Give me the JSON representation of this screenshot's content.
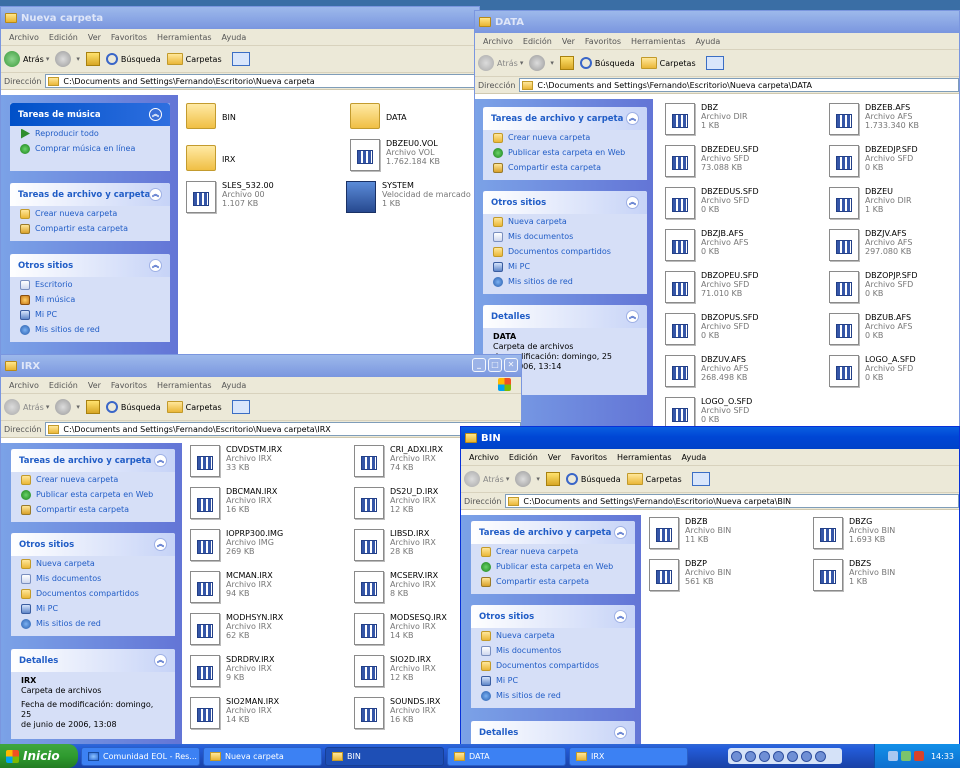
{
  "menu": [
    "Archivo",
    "Edición",
    "Ver",
    "Favoritos",
    "Herramientas",
    "Ayuda"
  ],
  "toolbar": {
    "back": "Atrás",
    "search": "Búsqueda",
    "folders": "Carpetas"
  },
  "address_label": "Dirección",
  "colors": {
    "titlebar_active": "#0a5fe0",
    "panel": "#7ba2e7",
    "task_header": "#215dc6",
    "start": "#3fa63f"
  },
  "windows": {
    "nueva": {
      "title": "Nueva carpeta",
      "address": "C:\\Documents and Settings\\Fernando\\Escritorio\\Nueva carpeta",
      "music_header": "Tareas de música",
      "music_items": [
        "Reproducir todo",
        "Comprar música en línea"
      ],
      "file_tasks_header": "Tareas de archivo y carpeta",
      "file_tasks": [
        "Crear nueva carpeta",
        "Compartir esta carpeta"
      ],
      "other_header": "Otros sitios",
      "other": [
        "Escritorio",
        "Mi música",
        "Mi PC",
        "Mis sitios de red"
      ],
      "files": [
        {
          "name": "BIN",
          "type": "",
          "size": "",
          "icon": "folder"
        },
        {
          "name": "DATA",
          "type": "",
          "size": "",
          "icon": "folder"
        },
        {
          "name": "IRX",
          "type": "",
          "size": "",
          "icon": "folder"
        },
        {
          "name": "DBZEU0.VOL",
          "type": "Archivo VOL",
          "size": "1.762.184 KB",
          "icon": "doc"
        },
        {
          "name": "SLES_532.00",
          "type": "Archivo 00",
          "size": "1.107 KB",
          "icon": "doc"
        },
        {
          "name": "SYSTEM",
          "type": "Velocidad de marcado",
          "size": "1 KB",
          "icon": "sys"
        }
      ]
    },
    "data": {
      "title": "DATA",
      "address": "C:\\Documents and Settings\\Fernando\\Escritorio\\Nueva carpeta\\DATA",
      "file_tasks_header": "Tareas de archivo y carpeta",
      "file_tasks": [
        "Crear nueva carpeta",
        "Publicar esta carpeta en Web",
        "Compartir esta carpeta"
      ],
      "other_header": "Otros sitios",
      "other": [
        "Nueva carpeta",
        "Mis documentos",
        "Documentos compartidos",
        "Mi PC",
        "Mis sitios de red"
      ],
      "details_header": "Detalles",
      "details_name": "DATA",
      "details_type": "Carpeta de archivos",
      "details_mod": "de modificación: domingo, 25",
      "details_date": "o de 2006, 13:14",
      "files": [
        {
          "name": "DBZ",
          "type": "Archivo DIR",
          "size": "1 KB"
        },
        {
          "name": "DBZEB.AFS",
          "type": "Archivo AFS",
          "size": "1.733.340 KB"
        },
        {
          "name": "DBZEDEU.SFD",
          "type": "Archivo SFD",
          "size": "73.088 KB"
        },
        {
          "name": "DBZEDJP.SFD",
          "type": "Archivo SFD",
          "size": "0 KB"
        },
        {
          "name": "DBZEDUS.SFD",
          "type": "Archivo SFD",
          "size": "0 KB"
        },
        {
          "name": "DBZEU",
          "type": "Archivo DIR",
          "size": "1 KB"
        },
        {
          "name": "DBZJB.AFS",
          "type": "Archivo AFS",
          "size": "0 KB"
        },
        {
          "name": "DBZJV.AFS",
          "type": "Archivo AFS",
          "size": "297.080 KB"
        },
        {
          "name": "DBZOPEU.SFD",
          "type": "Archivo SFD",
          "size": "71.010 KB"
        },
        {
          "name": "DBZOPJP.SFD",
          "type": "Archivo SFD",
          "size": "0 KB"
        },
        {
          "name": "DBZOPUS.SFD",
          "type": "Archivo SFD",
          "size": "0 KB"
        },
        {
          "name": "DBZUB.AFS",
          "type": "Archivo AFS",
          "size": "0 KB"
        },
        {
          "name": "DBZUV.AFS",
          "type": "Archivo AFS",
          "size": "268.498 KB"
        },
        {
          "name": "LOGO_A.SFD",
          "type": "Archivo SFD",
          "size": "0 KB"
        },
        {
          "name": "LOGO_O.SFD",
          "type": "Archivo SFD",
          "size": "0 KB"
        }
      ]
    },
    "irx": {
      "title": "IRX",
      "address": "C:\\Documents and Settings\\Fernando\\Escritorio\\Nueva carpeta\\IRX",
      "file_tasks_header": "Tareas de archivo y carpeta",
      "file_tasks": [
        "Crear nueva carpeta",
        "Publicar esta carpeta en Web",
        "Compartir esta carpeta"
      ],
      "other_header": "Otros sitios",
      "other": [
        "Nueva carpeta",
        "Mis documentos",
        "Documentos compartidos",
        "Mi PC",
        "Mis sitios de red"
      ],
      "details_header": "Detalles",
      "details_name": "IRX",
      "details_type": "Carpeta de archivos",
      "details_mod": "Fecha de modificación: domingo, 25",
      "details_date": "de junio de 2006, 13:08",
      "files": [
        {
          "name": "CDVDSTM.IRX",
          "type": "Archivo IRX",
          "size": "33 KB"
        },
        {
          "name": "CRI_ADXI.IRX",
          "type": "Archivo IRX",
          "size": "74 KB"
        },
        {
          "name": "DBCMAN.IRX",
          "type": "Archivo IRX",
          "size": "16 KB"
        },
        {
          "name": "DS2U_D.IRX",
          "type": "Archivo IRX",
          "size": "12 KB"
        },
        {
          "name": "IOPRP300.IMG",
          "type": "Archivo IMG",
          "size": "269 KB"
        },
        {
          "name": "LIBSD.IRX",
          "type": "Archivo IRX",
          "size": "28 KB"
        },
        {
          "name": "MCMAN.IRX",
          "type": "Archivo IRX",
          "size": "94 KB"
        },
        {
          "name": "MCSERV.IRX",
          "type": "Archivo IRX",
          "size": "8 KB"
        },
        {
          "name": "MODHSYN.IRX",
          "type": "Archivo IRX",
          "size": "62 KB"
        },
        {
          "name": "MODSESQ.IRX",
          "type": "Archivo IRX",
          "size": "14 KB"
        },
        {
          "name": "SDRDRV.IRX",
          "type": "Archivo IRX",
          "size": "9 KB"
        },
        {
          "name": "SIO2D.IRX",
          "type": "Archivo IRX",
          "size": "12 KB"
        },
        {
          "name": "SIO2MAN.IRX",
          "type": "Archivo IRX",
          "size": "14 KB"
        },
        {
          "name": "SOUNDS.IRX",
          "type": "Archivo IRX",
          "size": "16 KB"
        }
      ]
    },
    "bin": {
      "title": "BIN",
      "address": "C:\\Documents and Settings\\Fernando\\Escritorio\\Nueva carpeta\\BIN",
      "file_tasks_header": "Tareas de archivo y carpeta",
      "file_tasks": [
        "Crear nueva carpeta",
        "Publicar esta carpeta en Web",
        "Compartir esta carpeta"
      ],
      "other_header": "Otros sitios",
      "other": [
        "Nueva carpeta",
        "Mis documentos",
        "Documentos compartidos",
        "Mi PC",
        "Mis sitios de red"
      ],
      "details_header": "Detalles",
      "files": [
        {
          "name": "DBZB",
          "type": "Archivo BIN",
          "size": "11 KB"
        },
        {
          "name": "DBZG",
          "type": "Archivo BIN",
          "size": "1.693 KB"
        },
        {
          "name": "DBZP",
          "type": "Archivo BIN",
          "size": "561 KB"
        },
        {
          "name": "DBZS",
          "type": "Archivo BIN",
          "size": "1 KB"
        }
      ]
    }
  },
  "taskbar": {
    "start": "Inicio",
    "buttons": [
      "Comunidad EOL - Res...",
      "Nueva carpeta",
      "BIN",
      "DATA",
      "IRX"
    ],
    "clock": "14:33"
  }
}
